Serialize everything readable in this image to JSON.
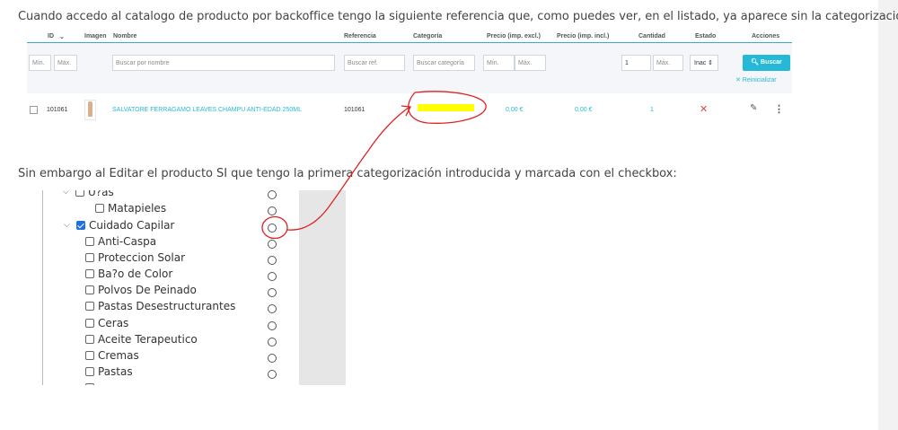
{
  "intro_text": "Cuando accedo al catalogo de producto por backoffice tengo la siguiente referencia que, como puedes ver, en el listado, ya aparece sin la categorización:",
  "second_text": "Sin embargo al Editar el producto SI que tengo la primera categorización introducida y marcada con el checkbox:",
  "product_list": {
    "headers": {
      "id": "ID",
      "imagen": "Imagen",
      "nombre": "Nombre",
      "referencia": "Referencia",
      "categoria": "Categoría",
      "precio_excl": "Precio (imp. excl.)",
      "precio_incl": "Precio (imp. incl.)",
      "cantidad": "Cantidad",
      "estado": "Estado",
      "acciones": "Acciones"
    },
    "filters": {
      "id_min": "Mín.",
      "id_max": "Máx.",
      "nombre": "Buscar por nombre",
      "referencia": "Buscar ref.",
      "categoria": "Buscar categoría",
      "precio_min": "Mín.",
      "precio_max": "Máx.",
      "cantidad_min": "1",
      "cantidad_max": "Máx.",
      "estado": "Inac ⇕"
    },
    "search_button": "Buscar",
    "search_icon": "magnifier-icon",
    "reset_link": "✕ Reinicializar",
    "row": {
      "id": "101061",
      "nombre": "SALVATORE FERRAGAMO LEAVES CHAMPU ANTI-EDAD 250ML",
      "referencia": "101061",
      "precio_excl": "0,00 €",
      "precio_incl": "0,00 €",
      "cantidad": "1",
      "estado_icon": "✕",
      "edit_icon": "pencil-icon",
      "menu_icon": "kebab-icon"
    }
  },
  "category_tree": {
    "items": [
      {
        "label": "U?as",
        "checked": false,
        "level": 1,
        "expanded": true
      },
      {
        "label": "Matapieles",
        "checked": false,
        "level": 2
      },
      {
        "label": "Cuidado Capilar",
        "checked": true,
        "level": 1,
        "expanded": true
      },
      {
        "label": "Anti-Caspa",
        "checked": false,
        "level": 2
      },
      {
        "label": "Proteccion Solar",
        "checked": false,
        "level": 2
      },
      {
        "label": "Ba?o de Color",
        "checked": false,
        "level": 2
      },
      {
        "label": "Polvos De Peinado",
        "checked": false,
        "level": 2
      },
      {
        "label": "Pastas Desestructurantes",
        "checked": false,
        "level": 2
      },
      {
        "label": "Ceras",
        "checked": false,
        "level": 2
      },
      {
        "label": "Aceite Terapeutico",
        "checked": false,
        "level": 2
      },
      {
        "label": "Cremas",
        "checked": false,
        "level": 2
      },
      {
        "label": "Pastas",
        "checked": false,
        "level": 2
      }
    ]
  },
  "colors": {
    "accent": "#25b9d7",
    "highlight": "#ffff00",
    "annotation": "#e02020",
    "checkbox_checked": "#1f6fe0"
  }
}
